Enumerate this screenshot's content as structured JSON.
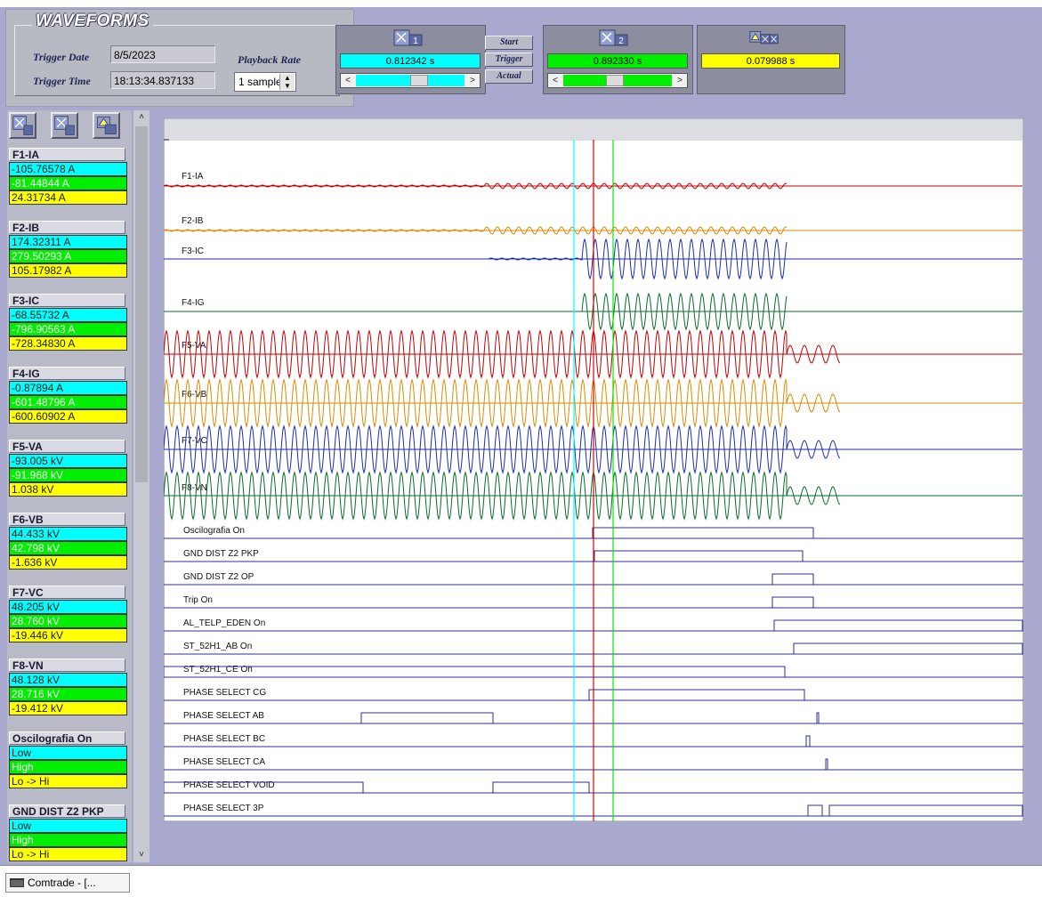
{
  "header": {
    "title": "WAVEFORMS",
    "trigger_date_label": "Trigger Date",
    "trigger_date": "8/5/2023",
    "trigger_time_label": "Trigger Time",
    "trigger_time": "18:13:34.837133",
    "playback_rate_label": "Playback Rate",
    "playback_rate": "1 sample"
  },
  "cursors": {
    "cursor1": {
      "icon": "cursor-1-icon",
      "label": "1",
      "value": "0.812342 s",
      "color": "#00ffff",
      "position": 0.6
    },
    "cursor2": {
      "icon": "cursor-2-icon",
      "label": "2",
      "value": "0.892330 s",
      "color": "#00ee00",
      "position": 0.47
    },
    "delta": {
      "icon": "delta-icon",
      "value": "0.079988 s",
      "color": "#ffff00"
    }
  },
  "buttons": {
    "start": "Start",
    "trigger": "Trigger",
    "actual": "Actual"
  },
  "left_panel": {
    "groups": [
      {
        "name": "F1-IA",
        "values": [
          "-105.76578 A",
          "-81.44844 A",
          "24.31734 A"
        ]
      },
      {
        "name": "F2-IB",
        "values": [
          "174.32311 A",
          "279.50293 A",
          "105.17982 A"
        ]
      },
      {
        "name": "F3-IC",
        "values": [
          "-68.55732 A",
          "-796.90563 A",
          "-728.34830 A"
        ]
      },
      {
        "name": "F4-IG",
        "values": [
          "-0.87894 A",
          "-601.48796 A",
          "-600.60902 A"
        ]
      },
      {
        "name": "F5-VA",
        "values": [
          "-93.005 kV",
          "-91.968 kV",
          "1.038 kV"
        ]
      },
      {
        "name": "F6-VB",
        "values": [
          "44.433 kV",
          "42.798 kV",
          "-1.636 kV"
        ]
      },
      {
        "name": "F7-VC",
        "values": [
          "48.205 kV",
          "28.760 kV",
          "-19.446 kV"
        ]
      },
      {
        "name": "F8-VN",
        "values": [
          "48.128 kV",
          "28.716 kV",
          "-19.412 kV"
        ]
      },
      {
        "name": "Oscilografia On",
        "values": [
          "Low",
          "High",
          "Lo -> Hi"
        ]
      },
      {
        "name": "GND DIST Z2 PKP",
        "values": [
          "Low",
          "High",
          "Lo -> Hi"
        ]
      }
    ]
  },
  "plot": {
    "analog_channels": [
      {
        "name": "F1-IA",
        "color": "#c00000"
      },
      {
        "name": "F2-IB",
        "color": "#d98b00"
      },
      {
        "name": "F3-IC",
        "color": "#1b2db0"
      },
      {
        "name": "F4-IG",
        "color": "#0a6b2b"
      },
      {
        "name": "F5-VA",
        "color": "#c00000"
      },
      {
        "name": "F6-VB",
        "color": "#d98b00"
      },
      {
        "name": "F7-VC",
        "color": "#1b2db0"
      },
      {
        "name": "F8-VN",
        "color": "#0a6b2b"
      }
    ],
    "digital_channels": [
      {
        "name": "Oscilografia On"
      },
      {
        "name": "GND DIST Z2 PKP"
      },
      {
        "name": "GND DIST Z2 OP"
      },
      {
        "name": "Trip      On"
      },
      {
        "name": "AL_TELP_EDEN On"
      },
      {
        "name": "ST_52H1_AB  On"
      },
      {
        "name": "ST_52H1_CE  On"
      },
      {
        "name": "PHASE SELECT CG"
      },
      {
        "name": "PHASE SELECT AB"
      },
      {
        "name": "PHASE SELECT BC"
      },
      {
        "name": "PHASE SELECT CA"
      },
      {
        "name": "PHASE SELECT VOID"
      },
      {
        "name": "PHASE SELECT 3P"
      }
    ],
    "trigger_line_color": "#e00000"
  },
  "status_bar": {
    "taskbar_label": "Comtrade - [..."
  }
}
